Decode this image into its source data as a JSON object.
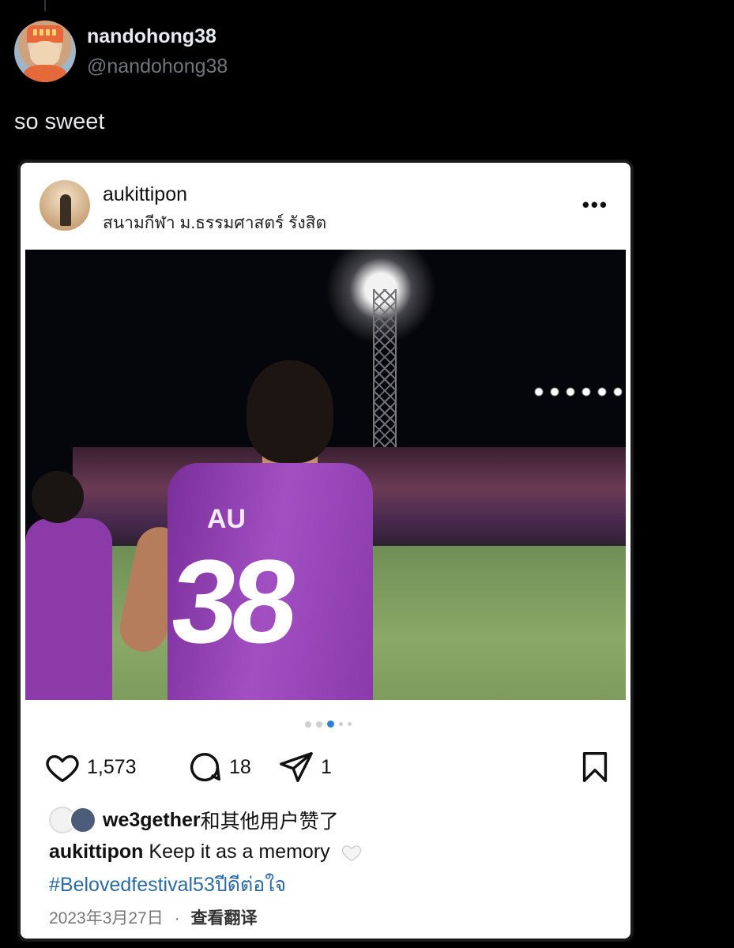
{
  "tweet": {
    "display_name": "nandohong38",
    "handle": "@nandohong38",
    "text": "so sweet"
  },
  "post": {
    "username": "aukittipon",
    "location": "สนามกีฬา ม.ธรรมศาสตร์ รังสิต",
    "more_icon": "more-dots-icon",
    "photo": {
      "jersey_name": "AU",
      "jersey_number": "38"
    },
    "carousel": {
      "count": 5,
      "active_index": 2
    },
    "actions": {
      "likes": "1,573",
      "comments": "18",
      "shares": "1"
    },
    "liked_by_user": "we3gether",
    "liked_by_suffix": "和其他用户赞了",
    "caption_user": "aukittipon",
    "caption_text": "Keep it as a memory",
    "hashtag": "#Belovedfestival53ปีดีต่อใจ",
    "date": "2023年3月27日",
    "separator": "·",
    "translate_label": "查看翻译"
  },
  "colors": {
    "background": "#000000",
    "text": "#e7e9ea",
    "muted": "#71767b",
    "hashtag": "#2e6aa0",
    "jersey": "#9b4dbf"
  }
}
